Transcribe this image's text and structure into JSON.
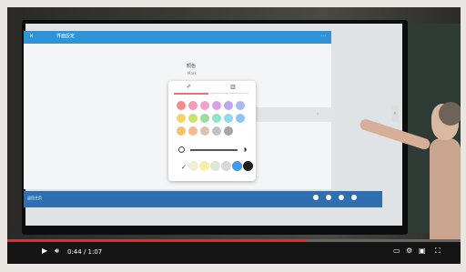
{
  "app": {
    "title": "界面設定",
    "page_title": "顏色",
    "page_subtitle": "Mark"
  },
  "palette": {
    "tabs": [
      "✐",
      "▥"
    ],
    "colors": [
      [
        "#f28b8b",
        "#f59ab6",
        "#f4a0c8",
        "#d9a2e8",
        "#b9a6f0",
        "#a9b9f4"
      ],
      [
        "#f3d46b",
        "#c9e46d",
        "#9ddc9b",
        "#8fe3cd",
        "#8fd7ec",
        "#8fc4f4"
      ],
      [
        "#f5c46a",
        "#f4b98c",
        "#d9c4a8",
        "#c2c2c2",
        "#a6a6a6",
        ""
      ]
    ],
    "bottom": [
      "#f0f0d8",
      "#f6f0a6",
      "#dfe8d6",
      "#d8d8d8",
      "#3d9bf0",
      "#202020"
    ]
  },
  "video": {
    "time": "0:44 / 1:07",
    "progress": 0.66
  },
  "bottom_bar": {
    "label": "返回主页"
  }
}
